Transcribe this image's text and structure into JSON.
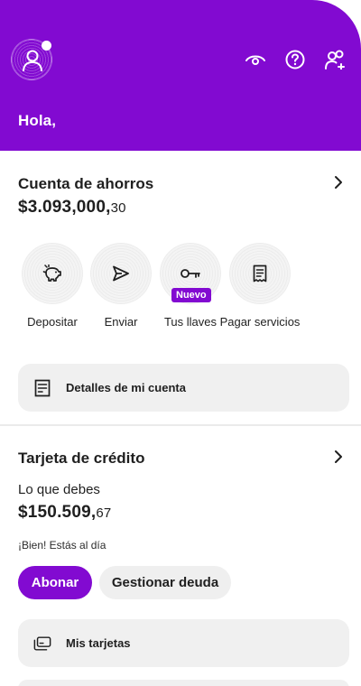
{
  "header": {
    "greeting": "Hola,",
    "icons": [
      "eye-icon",
      "help-icon",
      "invite-friends-icon"
    ]
  },
  "savings": {
    "title": "Cuenta de ahorros",
    "balance_main": "$3.093,000,",
    "balance_cents": "30",
    "actions": [
      {
        "label": "Depositar",
        "icon": "piggy-bank-icon"
      },
      {
        "label": "Enviar",
        "icon": "send-icon"
      },
      {
        "label": "Tus llaves",
        "icon": "key-icon",
        "badge": "Nuevo"
      },
      {
        "label": "Pagar servicios",
        "icon": "bill-icon"
      }
    ],
    "details_button": "Detalles de mi cuenta"
  },
  "credit": {
    "title": "Tarjeta de crédito",
    "owe_label": "Lo que debes",
    "balance_main": "$150.509,",
    "balance_cents": "67",
    "status": "¡Bien! Estás al día",
    "pay_button": "Abonar",
    "manage_button": "Gestionar deuda",
    "cards_button": "Mis tarjetas"
  },
  "colors": {
    "brand": "#820ad1",
    "surface": "#f0f0f0",
    "text": "#1f1f1f"
  }
}
